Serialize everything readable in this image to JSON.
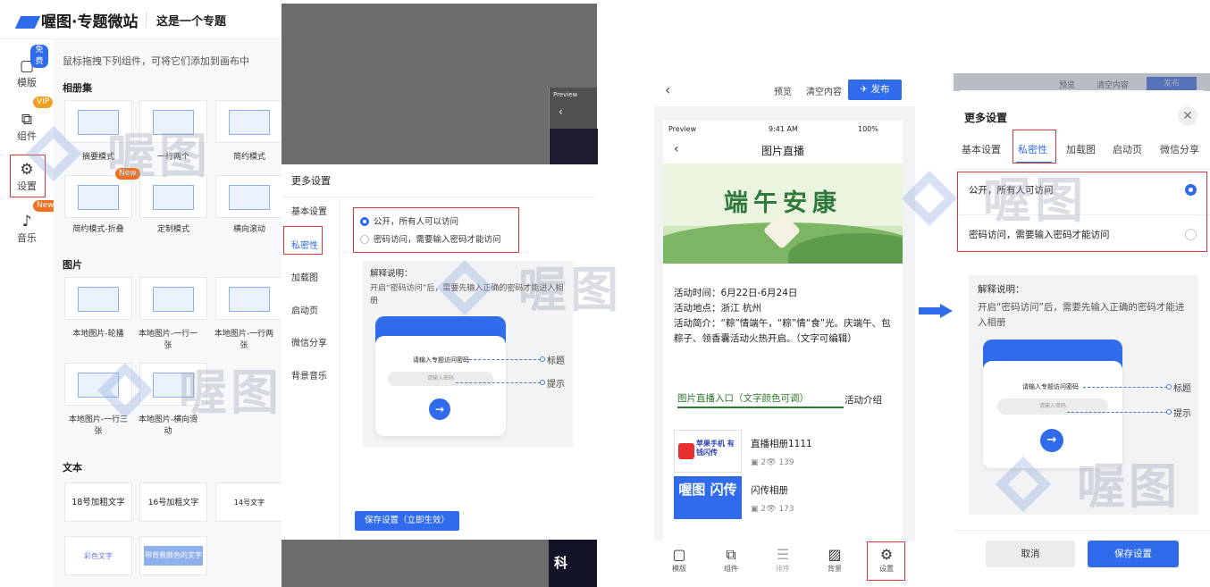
{
  "brand": {
    "logo_text": "喔图·专题微站",
    "project_title": "这是一个专题"
  },
  "side_nav": [
    {
      "label": "模版",
      "badge": "免费"
    },
    {
      "label": "组件",
      "badge": "VIP"
    },
    {
      "label": "设置",
      "badge": ""
    },
    {
      "label": "音乐",
      "badge": "New"
    }
  ],
  "components": {
    "hint": "鼠标拖拽下列组件，可将它们添加到画布中",
    "sections": {
      "album": "相册集",
      "image": "图片",
      "text": "文本"
    },
    "album_items": [
      "摘要模式",
      "一行两个",
      "简约模式",
      "简约模式-折叠",
      "定制模式",
      "横向滚动"
    ],
    "album_new_badge": "New",
    "image_items": [
      "本地图片-轮播",
      "本地图片-一行一张",
      "本地图片-一行两张",
      "本地图片-一行三张",
      "本地图片-横向滑动"
    ],
    "text_items": [
      "18号加粗文字",
      "16号加粗文字",
      "14号文字",
      "彩色文字",
      "带背景颜色的文字"
    ]
  },
  "watermark": "喔图",
  "preview_mini": {
    "label": "Preview"
  },
  "settings": {
    "title": "更多设置",
    "tabs": [
      "基本设置",
      "私密性",
      "加载图",
      "启动页",
      "微信分享",
      "背景音乐"
    ],
    "options": [
      "公开，所有人可以访问",
      "密码访问，需要输入密码才能访问"
    ],
    "explain_title": "解释说明：",
    "explain_text": "开启“密码访问”后，需要先输入正确的密码才能进入相册",
    "card_title": "请输入专题访问密码",
    "card_placeholder": "请输入密码",
    "callout_title": "标题",
    "callout_hint": "提示",
    "save_button": "保存设置（立即生效）"
  },
  "dark_bottom_text": "科",
  "editor": {
    "back": "‹",
    "preview": "预览",
    "clear": "清空内容",
    "publish": "发布"
  },
  "phone": {
    "status_left": "Preview",
    "status_time": "9:41 AM",
    "status_battery": "100%",
    "nav_title": "图片直播",
    "banner_title": "端午安康",
    "info_time": "活动时间：6月22日-6月24日",
    "info_place": "活动地点：浙江 杭州",
    "info_intro": "活动简介：“粽”情端午，“粽”情“食”光。庆端午、包粽子、领香囊活动火热开启。（文字可编辑）",
    "entry_label": "图片直播入口（文字颜色可调）",
    "intro_label": "活动介绍",
    "albums": [
      {
        "name": "直播相册1111",
        "count": "2",
        "views": "139",
        "thumb_text": "苹果手机 有钱闪传"
      },
      {
        "name": "闪传相册",
        "count": "2",
        "views": "173",
        "thumb_text": "喔图 闪传"
      }
    ]
  },
  "tabbar": [
    {
      "label": "模版",
      "icon": "template-icon"
    },
    {
      "label": "组件",
      "icon": "component-icon"
    },
    {
      "label": "排序",
      "icon": "sort-icon"
    },
    {
      "label": "背景",
      "icon": "background-icon"
    },
    {
      "label": "设置",
      "icon": "gear-icon"
    }
  ],
  "mobile_settings": {
    "top_preview": "预览",
    "top_clear": "清空内容",
    "top_publish": "发布",
    "title": "更多设置",
    "tabs": [
      "基本设置",
      "私密性",
      "加载图",
      "启动页",
      "微信分享"
    ],
    "options": [
      "公开，所有人可访问",
      "密码访问，需要输入密码才能访问"
    ],
    "explain_title": "解释说明：",
    "explain_text": "开启“密码访问”后，需要先输入正确的密码才能进入相册",
    "card_title": "请输入专题访问密码",
    "card_placeholder": "请输入密码",
    "callout_title": "标题",
    "callout_hint": "提示",
    "cancel": "取消",
    "save": "保存设置"
  },
  "colors": {
    "accent": "#2f6bea",
    "highlight": "#d9363e"
  }
}
